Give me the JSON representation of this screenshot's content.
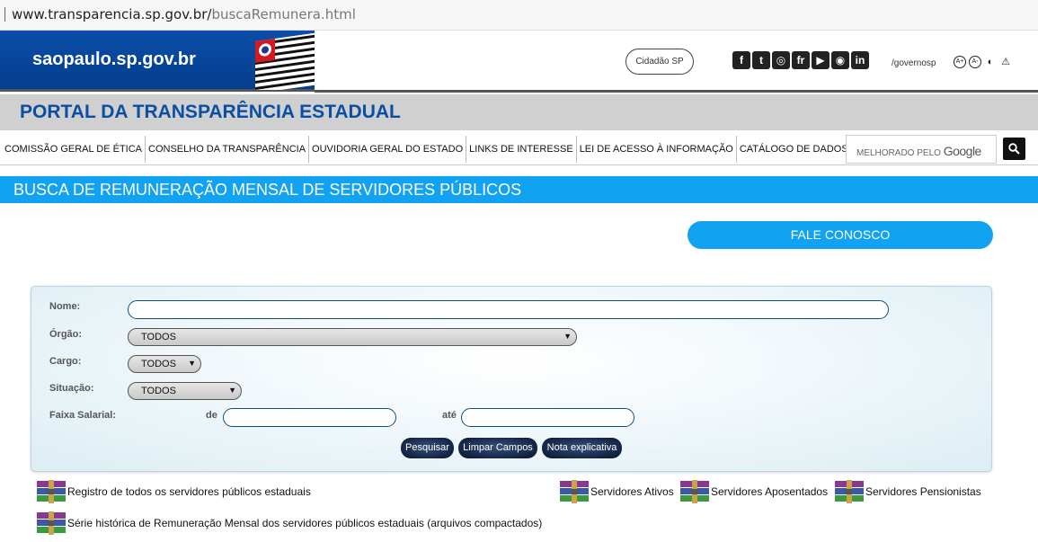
{
  "browser": {
    "url_host": "www.transparencia.sp.gov.br/",
    "url_path": "buscaRemunera.html"
  },
  "header": {
    "brand": "saopaulo.sp.gov.br",
    "cidadao_button": "Cidadão SP",
    "social_icons": [
      "facebook-icon",
      "twitter-icon",
      "instagram-icon",
      "flickr-icon",
      "youtube-icon",
      "periscope-icon",
      "linkedin-icon"
    ],
    "social_glyphs": [
      "f",
      "t",
      "◎",
      "fr",
      "▶",
      "◉",
      "in"
    ],
    "handle": "/governosp",
    "accessibility_icons": [
      "font-increase-icon",
      "font-decrease-icon",
      "contrast-icon",
      "warning-icon"
    ]
  },
  "portal": {
    "title": "PORTAL DA TRANSPARÊNCIA ESTADUAL"
  },
  "nav": {
    "items": [
      "COMISSÃO GERAL DE ÉTICA",
      "CONSELHO DA TRANSPARÊNCIA",
      "OUVIDORIA GERAL DO ESTADO",
      "LINKS DE INTERESSE",
      "LEI DE ACESSO À INFORMAÇÃO",
      "CATÁLOGO DE DADOS"
    ],
    "search_prefix": "MELHORADO PELO",
    "search_brand": "Google"
  },
  "section": {
    "title": "BUSCA DE REMUNERAÇÃO MENSAL DE SERVIDORES PÚBLICOS"
  },
  "contact_button": "FALE CONOSCO",
  "form": {
    "nome_label": "Nome:",
    "nome_value": "",
    "orgao_label": "Órgão:",
    "orgao_value": "TODOS",
    "cargo_label": "Cargo:",
    "cargo_value": "TODOS",
    "situacao_label": "Situação:",
    "situacao_value": "TODOS",
    "faixa_label": "Faixa Salarial:",
    "de_label": "de",
    "ate_label": "até",
    "de_value": "",
    "ate_value": "",
    "buttons": {
      "search": "Pesquisar",
      "clear": "Limpar Campos",
      "note": "Nota explicativa"
    }
  },
  "downloads": {
    "all": "Registro de todos os servidores públicos estaduais",
    "ativos": "Servidores Ativos",
    "aposentados": "Servidores Aposentados",
    "pensionistas": "Servidores Pensionistas",
    "historica": "Série histórica de Remuneração Mensal dos servidores públicos estaduais (arquivos compactados)"
  }
}
